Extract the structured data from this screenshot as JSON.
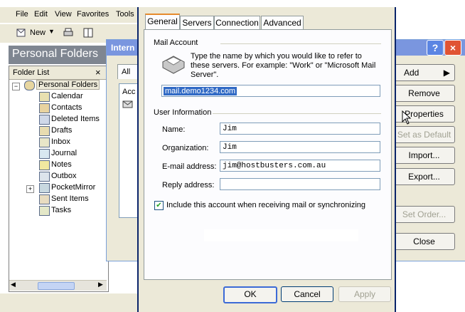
{
  "menubar": {
    "items": [
      "File",
      "Edit",
      "View",
      "Favorites",
      "Tools"
    ]
  },
  "toolbar": {
    "new_label": "New"
  },
  "personal_folders_title": "Personal Folders",
  "folder_list": {
    "header": "Folder List",
    "close": "×",
    "root": "Personal Folders",
    "items": [
      "Calendar",
      "Contacts",
      "Deleted Items",
      "Drafts",
      "Inbox",
      "Journal",
      "Notes",
      "Outbox",
      "PocketMirror",
      "Sent Items",
      "Tasks"
    ]
  },
  "accounts_dialog": {
    "title": "Intern",
    "help": "?",
    "close": "×",
    "tab_all": "All",
    "list_header": "Acc",
    "buttons": {
      "add": "Add",
      "remove": "Remove",
      "properties": "Properties",
      "set_default": "Set as Default",
      "import": "Import...",
      "export": "Export...",
      "set_order": "Set Order...",
      "close": "Close"
    }
  },
  "properties_dialog": {
    "tabs": [
      "General",
      "Servers",
      "Connection",
      "Advanced"
    ],
    "mail_account": {
      "group": "Mail Account",
      "description": "Type the name by which you would like to refer to these servers.  For example: \"Work\" or \"Microsoft Mail Server\".",
      "value": "mail.demo1234.com"
    },
    "user_info": {
      "group": "User Information",
      "name_label": "Name:",
      "name_value": "Jim",
      "org_label": "Organization:",
      "org_value": "Jim",
      "email_label": "E-mail address:",
      "email_value": "jim@hostbusters.com.au",
      "reply_label": "Reply address:",
      "reply_value": ""
    },
    "include_label": "Include this account when receiving mail or synchronizing",
    "include_checked": true,
    "buttons": {
      "ok": "OK",
      "cancel": "Cancel",
      "apply": "Apply"
    }
  },
  "colors": {
    "titlebar": "#7a96df",
    "tab_highlight": "#e68b2c",
    "selection": "#316ac5"
  }
}
